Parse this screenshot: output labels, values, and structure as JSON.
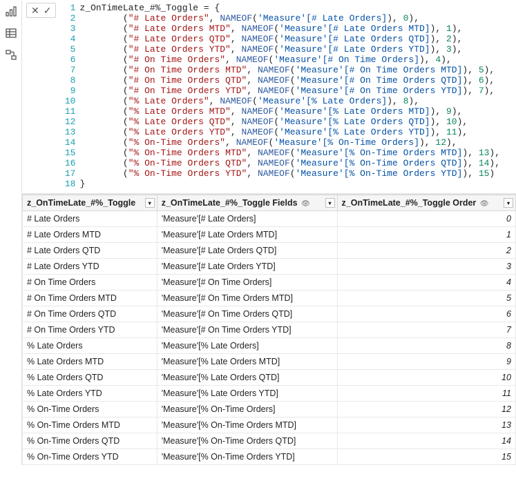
{
  "editor": {
    "lines": [
      {
        "n": 1,
        "tokens": [
          {
            "t": "z_OnTimeLate_#%_Toggle = {",
            "c": "p"
          }
        ]
      },
      {
        "n": 2,
        "tokens": [
          {
            "t": "        (",
            "c": "p"
          },
          {
            "t": "\"# Late Orders\"",
            "c": "s"
          },
          {
            "t": ", ",
            "c": "p"
          },
          {
            "t": "NAMEOF",
            "c": "k"
          },
          {
            "t": "(",
            "c": "p"
          },
          {
            "t": "'Measure'[# Late Orders]",
            "c": "m"
          },
          {
            "t": "), ",
            "c": "p"
          },
          {
            "t": "0",
            "c": "n"
          },
          {
            "t": "),",
            "c": "p"
          }
        ]
      },
      {
        "n": 3,
        "tokens": [
          {
            "t": "        (",
            "c": "p"
          },
          {
            "t": "\"# Late Orders MTD\"",
            "c": "s"
          },
          {
            "t": ", ",
            "c": "p"
          },
          {
            "t": "NAMEOF",
            "c": "k"
          },
          {
            "t": "(",
            "c": "p"
          },
          {
            "t": "'Measure'[# Late Orders MTD]",
            "c": "m"
          },
          {
            "t": "), ",
            "c": "p"
          },
          {
            "t": "1",
            "c": "n"
          },
          {
            "t": "),",
            "c": "p"
          }
        ]
      },
      {
        "n": 4,
        "tokens": [
          {
            "t": "        (",
            "c": "p"
          },
          {
            "t": "\"# Late Orders QTD\"",
            "c": "s"
          },
          {
            "t": ", ",
            "c": "p"
          },
          {
            "t": "NAMEOF",
            "c": "k"
          },
          {
            "t": "(",
            "c": "p"
          },
          {
            "t": "'Measure'[# Late Orders QTD]",
            "c": "m"
          },
          {
            "t": "), ",
            "c": "p"
          },
          {
            "t": "2",
            "c": "n"
          },
          {
            "t": "),",
            "c": "p"
          }
        ]
      },
      {
        "n": 5,
        "tokens": [
          {
            "t": "        (",
            "c": "p"
          },
          {
            "t": "\"# Late Orders YTD\"",
            "c": "s"
          },
          {
            "t": ", ",
            "c": "p"
          },
          {
            "t": "NAMEOF",
            "c": "k"
          },
          {
            "t": "(",
            "c": "p"
          },
          {
            "t": "'Measure'[# Late Orders YTD]",
            "c": "m"
          },
          {
            "t": "), ",
            "c": "p"
          },
          {
            "t": "3",
            "c": "n"
          },
          {
            "t": "),",
            "c": "p"
          }
        ]
      },
      {
        "n": 6,
        "tokens": [
          {
            "t": "        (",
            "c": "p"
          },
          {
            "t": "\"# On Time Orders\"",
            "c": "s"
          },
          {
            "t": ", ",
            "c": "p"
          },
          {
            "t": "NAMEOF",
            "c": "k"
          },
          {
            "t": "(",
            "c": "p"
          },
          {
            "t": "'Measure'[# On Time Orders]",
            "c": "m"
          },
          {
            "t": "), ",
            "c": "p"
          },
          {
            "t": "4",
            "c": "n"
          },
          {
            "t": "),",
            "c": "p"
          }
        ]
      },
      {
        "n": 7,
        "tokens": [
          {
            "t": "        (",
            "c": "p"
          },
          {
            "t": "\"# On Time Orders MTD\"",
            "c": "s"
          },
          {
            "t": ", ",
            "c": "p"
          },
          {
            "t": "NAMEOF",
            "c": "k"
          },
          {
            "t": "(",
            "c": "p"
          },
          {
            "t": "'Measure'[# On Time Orders MTD]",
            "c": "m"
          },
          {
            "t": "), ",
            "c": "p"
          },
          {
            "t": "5",
            "c": "n"
          },
          {
            "t": "),",
            "c": "p"
          }
        ]
      },
      {
        "n": 8,
        "tokens": [
          {
            "t": "        (",
            "c": "p"
          },
          {
            "t": "\"# On Time Orders QTD\"",
            "c": "s"
          },
          {
            "t": ", ",
            "c": "p"
          },
          {
            "t": "NAMEOF",
            "c": "k"
          },
          {
            "t": "(",
            "c": "p"
          },
          {
            "t": "'Measure'[# On Time Orders QTD]",
            "c": "m"
          },
          {
            "t": "), ",
            "c": "p"
          },
          {
            "t": "6",
            "c": "n"
          },
          {
            "t": "),",
            "c": "p"
          }
        ]
      },
      {
        "n": 9,
        "tokens": [
          {
            "t": "        (",
            "c": "p"
          },
          {
            "t": "\"# On Time Orders YTD\"",
            "c": "s"
          },
          {
            "t": ", ",
            "c": "p"
          },
          {
            "t": "NAMEOF",
            "c": "k"
          },
          {
            "t": "(",
            "c": "p"
          },
          {
            "t": "'Measure'[# On Time Orders YTD]",
            "c": "m"
          },
          {
            "t": "), ",
            "c": "p"
          },
          {
            "t": "7",
            "c": "n"
          },
          {
            "t": "),",
            "c": "p"
          }
        ]
      },
      {
        "n": 10,
        "tokens": [
          {
            "t": "        (",
            "c": "p"
          },
          {
            "t": "\"% Late Orders\"",
            "c": "s"
          },
          {
            "t": ", ",
            "c": "p"
          },
          {
            "t": "NAMEOF",
            "c": "k"
          },
          {
            "t": "(",
            "c": "p"
          },
          {
            "t": "'Measure'[% Late Orders]",
            "c": "m"
          },
          {
            "t": "), ",
            "c": "p"
          },
          {
            "t": "8",
            "c": "n"
          },
          {
            "t": "),",
            "c": "p"
          }
        ]
      },
      {
        "n": 11,
        "tokens": [
          {
            "t": "        (",
            "c": "p"
          },
          {
            "t": "\"% Late Orders MTD\"",
            "c": "s"
          },
          {
            "t": ", ",
            "c": "p"
          },
          {
            "t": "NAMEOF",
            "c": "k"
          },
          {
            "t": "(",
            "c": "p"
          },
          {
            "t": "'Measure'[% Late Orders MTD]",
            "c": "m"
          },
          {
            "t": "), ",
            "c": "p"
          },
          {
            "t": "9",
            "c": "n"
          },
          {
            "t": "),",
            "c": "p"
          }
        ]
      },
      {
        "n": 12,
        "tokens": [
          {
            "t": "        (",
            "c": "p"
          },
          {
            "t": "\"% Late Orders QTD\"",
            "c": "s"
          },
          {
            "t": ", ",
            "c": "p"
          },
          {
            "t": "NAMEOF",
            "c": "k"
          },
          {
            "t": "(",
            "c": "p"
          },
          {
            "t": "'Measure'[% Late Orders QTD]",
            "c": "m"
          },
          {
            "t": "), ",
            "c": "p"
          },
          {
            "t": "10",
            "c": "n"
          },
          {
            "t": "),",
            "c": "p"
          }
        ]
      },
      {
        "n": 13,
        "tokens": [
          {
            "t": "        (",
            "c": "p"
          },
          {
            "t": "\"% Late Orders YTD\"",
            "c": "s"
          },
          {
            "t": ", ",
            "c": "p"
          },
          {
            "t": "NAMEOF",
            "c": "k"
          },
          {
            "t": "(",
            "c": "p"
          },
          {
            "t": "'Measure'[% Late Orders YTD]",
            "c": "m"
          },
          {
            "t": "), ",
            "c": "p"
          },
          {
            "t": "11",
            "c": "n"
          },
          {
            "t": "),",
            "c": "p"
          }
        ]
      },
      {
        "n": 14,
        "tokens": [
          {
            "t": "        (",
            "c": "p"
          },
          {
            "t": "\"% On-Time Orders\"",
            "c": "s"
          },
          {
            "t": ", ",
            "c": "p"
          },
          {
            "t": "NAMEOF",
            "c": "k"
          },
          {
            "t": "(",
            "c": "p"
          },
          {
            "t": "'Measure'[% On-Time Orders]",
            "c": "m"
          },
          {
            "t": "), ",
            "c": "p"
          },
          {
            "t": "12",
            "c": "n"
          },
          {
            "t": "),",
            "c": "p"
          }
        ]
      },
      {
        "n": 15,
        "tokens": [
          {
            "t": "        (",
            "c": "p"
          },
          {
            "t": "\"% On-Time Orders MTD\"",
            "c": "s"
          },
          {
            "t": ", ",
            "c": "p"
          },
          {
            "t": "NAMEOF",
            "c": "k"
          },
          {
            "t": "(",
            "c": "p"
          },
          {
            "t": "'Measure'[% On-Time Orders MTD]",
            "c": "m"
          },
          {
            "t": "), ",
            "c": "p"
          },
          {
            "t": "13",
            "c": "n"
          },
          {
            "t": "),",
            "c": "p"
          }
        ]
      },
      {
        "n": 16,
        "tokens": [
          {
            "t": "        (",
            "c": "p"
          },
          {
            "t": "\"% On-Time Orders QTD\"",
            "c": "s"
          },
          {
            "t": ", ",
            "c": "p"
          },
          {
            "t": "NAMEOF",
            "c": "k"
          },
          {
            "t": "(",
            "c": "p"
          },
          {
            "t": "'Measure'[% On-Time Orders QTD]",
            "c": "m"
          },
          {
            "t": "), ",
            "c": "p"
          },
          {
            "t": "14",
            "c": "n"
          },
          {
            "t": "),",
            "c": "p"
          }
        ]
      },
      {
        "n": 17,
        "tokens": [
          {
            "t": "        (",
            "c": "p"
          },
          {
            "t": "\"% On-Time Orders YTD\"",
            "c": "s"
          },
          {
            "t": ", ",
            "c": "p"
          },
          {
            "t": "NAMEOF",
            "c": "k"
          },
          {
            "t": "(",
            "c": "p"
          },
          {
            "t": "'Measure'[% On-Time Orders YTD]",
            "c": "m"
          },
          {
            "t": "), ",
            "c": "p"
          },
          {
            "t": "15",
            "c": "n"
          },
          {
            "t": ")",
            "c": "p"
          }
        ]
      },
      {
        "n": 18,
        "tokens": [
          {
            "t": "}",
            "c": "p"
          }
        ]
      }
    ]
  },
  "table": {
    "columns": [
      "z_OnTimeLate_#%_Toggle",
      "z_OnTimeLate_#%_Toggle Fields",
      "z_OnTimeLate_#%_Toggle Order"
    ],
    "rows": [
      {
        "c0": "# Late Orders",
        "c1": "'Measure'[# Late Orders]",
        "c2": "0"
      },
      {
        "c0": "# Late Orders MTD",
        "c1": "'Measure'[# Late Orders MTD]",
        "c2": "1"
      },
      {
        "c0": "# Late Orders QTD",
        "c1": "'Measure'[# Late Orders QTD]",
        "c2": "2"
      },
      {
        "c0": "# Late Orders YTD",
        "c1": "'Measure'[# Late Orders YTD]",
        "c2": "3"
      },
      {
        "c0": "# On Time Orders",
        "c1": "'Measure'[# On Time Orders]",
        "c2": "4"
      },
      {
        "c0": "# On Time Orders MTD",
        "c1": "'Measure'[# On Time Orders MTD]",
        "c2": "5"
      },
      {
        "c0": "# On Time Orders QTD",
        "c1": "'Measure'[# On Time Orders QTD]",
        "c2": "6"
      },
      {
        "c0": "# On Time Orders YTD",
        "c1": "'Measure'[# On Time Orders YTD]",
        "c2": "7"
      },
      {
        "c0": "% Late Orders",
        "c1": "'Measure'[% Late Orders]",
        "c2": "8"
      },
      {
        "c0": "% Late Orders MTD",
        "c1": "'Measure'[% Late Orders MTD]",
        "c2": "9"
      },
      {
        "c0": "% Late Orders QTD",
        "c1": "'Measure'[% Late Orders QTD]",
        "c2": "10"
      },
      {
        "c0": "% Late Orders YTD",
        "c1": "'Measure'[% Late Orders YTD]",
        "c2": "11"
      },
      {
        "c0": "% On-Time Orders",
        "c1": "'Measure'[% On-Time Orders]",
        "c2": "12"
      },
      {
        "c0": "% On-Time Orders MTD",
        "c1": "'Measure'[% On-Time Orders MTD]",
        "c2": "13"
      },
      {
        "c0": "% On-Time Orders QTD",
        "c1": "'Measure'[% On-Time Orders QTD]",
        "c2": "14"
      },
      {
        "c0": "% On-Time Orders YTD",
        "c1": "'Measure'[% On-Time Orders YTD]",
        "c2": "15"
      }
    ]
  },
  "icons": {
    "cancel": "✕",
    "commit": "✓",
    "chevdown": "▾"
  }
}
